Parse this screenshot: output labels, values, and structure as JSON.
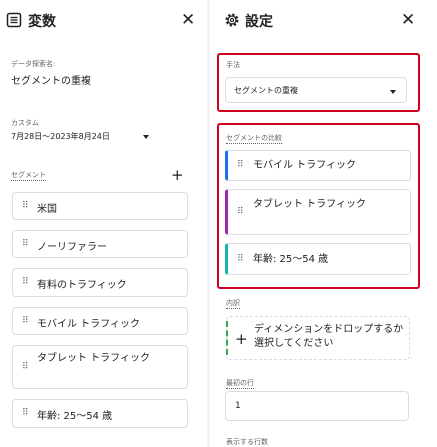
{
  "left": {
    "title": "変数",
    "dataset_label": "データ探索名:",
    "dataset_value": "セグメントの重複",
    "custom_label": "カスタム",
    "date_range": "7月28日～2023年8月24日",
    "segments_label": "セグメント",
    "segments": [
      "米国",
      "ノーリファラー",
      "有料のトラフィック",
      "モバイル トラフィック",
      "タブレット トラフィック",
      "年齢: 25～54 歳"
    ]
  },
  "right": {
    "title": "設定",
    "technique_label": "手法",
    "technique_value": "セグメントの重複",
    "compare_label": "セグメントの比較",
    "compare_segments": [
      {
        "name": "モバイル トラフィック",
        "color": "#1a73e8"
      },
      {
        "name": "タブレット トラフィック",
        "color": "#9c27b0"
      },
      {
        "name": "年齢: 25～54 歳",
        "color": "#12b5a9"
      }
    ],
    "breakdown_label": "内訳",
    "drop_text": "ディメンションをドロップするか選択してください",
    "first_row_label": "最初の行",
    "first_row_value": "1",
    "rows_label": "表示する行数"
  },
  "colors": {
    "highlight": "#d0021b",
    "accent_blue": "#1a73e8",
    "accent_purple": "#9c27b0",
    "accent_teal": "#12b5a9",
    "dashed_green": "#34a853"
  }
}
